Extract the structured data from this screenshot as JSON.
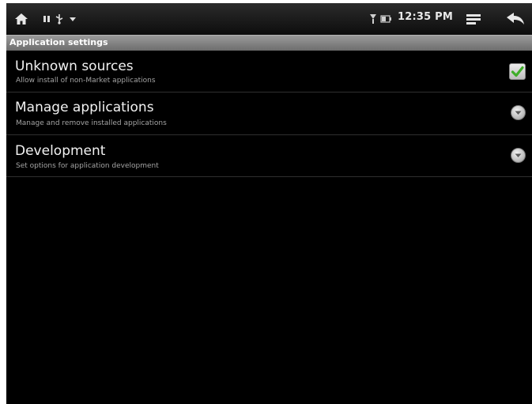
{
  "status_bar": {
    "time": "12:35 PM",
    "icons": [
      "home-icon",
      "debug-notification-icon",
      "usb-notification-icon",
      "download-notification-icon",
      "signal-icon",
      "battery-icon",
      "menu-icon",
      "back-arrow-icon"
    ]
  },
  "settings": {
    "section_header": "Application settings",
    "items": [
      {
        "title": "Unknown sources",
        "summary": "Allow install of non-Market applications",
        "widget": "checkbox",
        "checked": true
      },
      {
        "title": "Manage applications",
        "summary": "Manage and remove installed applications",
        "widget": "chevron"
      },
      {
        "title": "Development",
        "summary": "Set options for application development",
        "widget": "chevron"
      }
    ]
  },
  "colors": {
    "check_mark": "#3fae2a",
    "header_gradient_top": "#9a9a9a"
  }
}
